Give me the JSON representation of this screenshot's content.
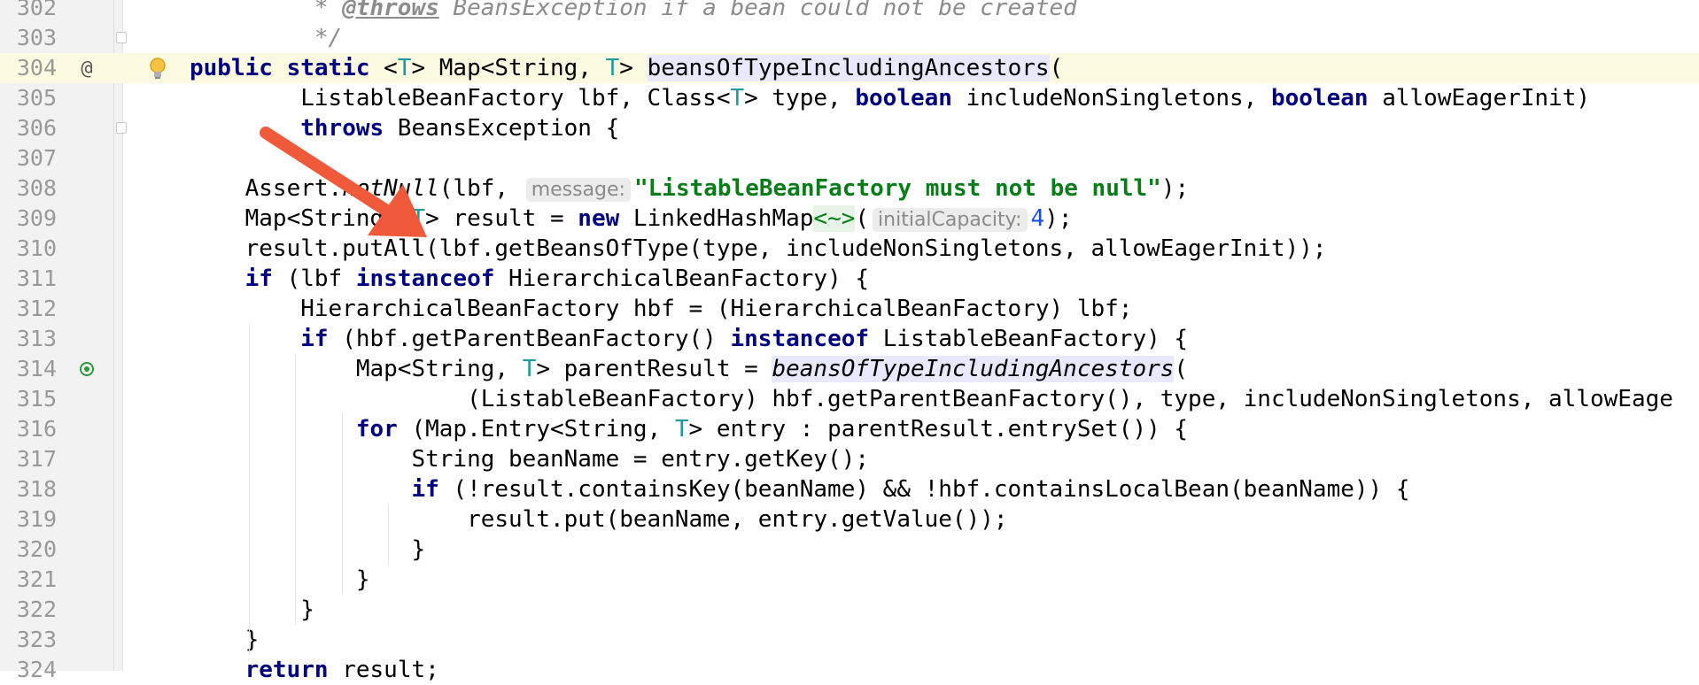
{
  "editor": {
    "lines": [
      {
        "num": "302",
        "segments": [
          {
            "t": "         * ",
            "c": "cm"
          },
          {
            "t": "@throws",
            "c": "cmtag"
          },
          {
            "t": " BeansException if a bean could not be created",
            "c": "cm"
          }
        ]
      },
      {
        "num": "303",
        "segments": [
          {
            "t": "         */",
            "c": "cm"
          }
        ]
      },
      {
        "num": "304",
        "current": true,
        "segments": [
          {
            "t": "public static ",
            "c": "kw"
          },
          {
            "t": "<"
          },
          {
            "t": "T",
            "c": "tp"
          },
          {
            "t": "> Map<String, "
          },
          {
            "t": "T",
            "c": "tp"
          },
          {
            "t": "> "
          },
          {
            "t": "",
            "c": "caret"
          },
          {
            "t": "beansOfTypeIncludingAncestors",
            "c": "hl"
          },
          {
            "t": "("
          }
        ]
      },
      {
        "num": "305",
        "segments": [
          {
            "t": "        ListableBeanFactory lbf, Class<"
          },
          {
            "t": "T",
            "c": "tp"
          },
          {
            "t": "> type, "
          },
          {
            "t": "boolean",
            "c": "kw"
          },
          {
            "t": " includeNonSingletons, "
          },
          {
            "t": "boolean",
            "c": "kw"
          },
          {
            "t": " allowEagerInit)"
          }
        ]
      },
      {
        "num": "306",
        "segments": [
          {
            "t": "        "
          },
          {
            "t": "throws",
            "c": "kw"
          },
          {
            "t": " BeansException {"
          }
        ]
      },
      {
        "num": "307",
        "segments": [
          {
            "t": ""
          }
        ]
      },
      {
        "num": "308",
        "segments": [
          {
            "t": "    Assert."
          },
          {
            "t": "notNull",
            "c": "it"
          },
          {
            "t": "(lbf, "
          },
          {
            "t": "message:",
            "c": "hint"
          },
          {
            "t": "\"ListableBeanFactory must not be null\"",
            "c": "str"
          },
          {
            "t": ");"
          }
        ]
      },
      {
        "num": "309",
        "segments": [
          {
            "t": "    Map<String, "
          },
          {
            "t": "T",
            "c": "tp"
          },
          {
            "t": "> result = "
          },
          {
            "t": "new",
            "c": "kw"
          },
          {
            "t": " LinkedHashMap"
          },
          {
            "t": "<~>",
            "c": "diamond"
          },
          {
            "t": "("
          },
          {
            "t": "initialCapacity:",
            "c": "hint"
          },
          {
            "t": "4",
            "c": "num"
          },
          {
            "t": ");"
          }
        ]
      },
      {
        "num": "310",
        "segments": [
          {
            "t": "    result.putAll(lbf.getBeansOfType(type, includeNonSingletons, allowEagerInit));"
          }
        ]
      },
      {
        "num": "311",
        "segments": [
          {
            "t": "    "
          },
          {
            "t": "if",
            "c": "kw"
          },
          {
            "t": " (lbf "
          },
          {
            "t": "instanceof",
            "c": "kw"
          },
          {
            "t": " HierarchicalBeanFactory) {"
          }
        ]
      },
      {
        "num": "312",
        "segments": [
          {
            "t": "        HierarchicalBeanFactory hbf = (HierarchicalBeanFactory) lbf;"
          }
        ]
      },
      {
        "num": "313",
        "segments": [
          {
            "t": "        "
          },
          {
            "t": "if",
            "c": "kw"
          },
          {
            "t": " (hbf.getParentBeanFactory() "
          },
          {
            "t": "instanceof",
            "c": "kw"
          },
          {
            "t": " ListableBeanFactory) {"
          }
        ]
      },
      {
        "num": "314",
        "segments": [
          {
            "t": "            Map<String, "
          },
          {
            "t": "T",
            "c": "tp"
          },
          {
            "t": "> parentResult = "
          },
          {
            "t": "beansOfTypeIncludingAncestors",
            "c": "it hl"
          },
          {
            "t": "("
          }
        ]
      },
      {
        "num": "315",
        "segments": [
          {
            "t": "                    (ListableBeanFactory) hbf.getParentBeanFactory(), type, includeNonSingletons, allowEage"
          }
        ]
      },
      {
        "num": "316",
        "segments": [
          {
            "t": "            "
          },
          {
            "t": "for",
            "c": "kw"
          },
          {
            "t": " (Map.Entry<String, "
          },
          {
            "t": "T",
            "c": "tp"
          },
          {
            "t": "> entry : parentResult.entrySet()) {"
          }
        ]
      },
      {
        "num": "317",
        "segments": [
          {
            "t": "                String beanName = entry.getKey();"
          }
        ]
      },
      {
        "num": "318",
        "segments": [
          {
            "t": "                "
          },
          {
            "t": "if",
            "c": "kw"
          },
          {
            "t": " (!result.containsKey(beanName) && !hbf.containsLocalBean(beanName)) {"
          }
        ]
      },
      {
        "num": "319",
        "segments": [
          {
            "t": "                    result.put(beanName, entry.getValue());"
          }
        ]
      },
      {
        "num": "320",
        "segments": [
          {
            "t": "                }"
          }
        ]
      },
      {
        "num": "321",
        "segments": [
          {
            "t": "            }"
          }
        ]
      },
      {
        "num": "322",
        "segments": [
          {
            "t": "        }"
          }
        ]
      },
      {
        "num": "323",
        "segments": [
          {
            "t": "    }"
          }
        ]
      },
      {
        "num": "324",
        "segments": [
          {
            "t": "    "
          },
          {
            "t": "return",
            "c": "kw"
          },
          {
            "t": " result;"
          }
        ]
      }
    ],
    "gutter_icons": [
      {
        "line": "304",
        "icon": "at-sign-annotation-icon",
        "glyph": "@"
      },
      {
        "line": "304",
        "icon": "lightbulb-intention-icon"
      },
      {
        "line": "314",
        "icon": "recursive-call-icon"
      }
    ]
  },
  "annotation": {
    "icon": "red-arrow-icon",
    "color": "#f05a3a"
  }
}
